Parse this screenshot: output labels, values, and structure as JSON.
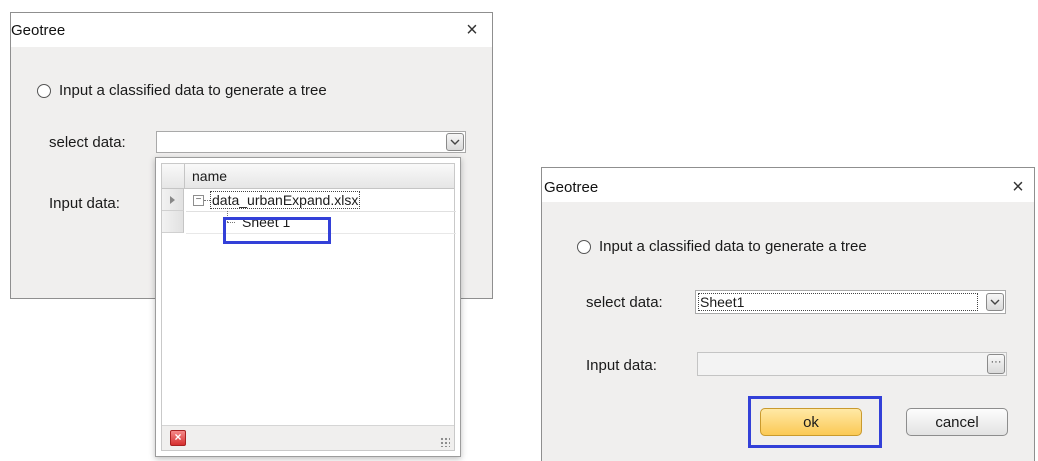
{
  "left_dialog": {
    "title": "Geotree",
    "close_glyph": "×",
    "radio_label": "Input a classified data to generate a tree",
    "select_label": "select data:",
    "input_label": "Input data:",
    "select_value": "",
    "dropdown": {
      "column_header": "name",
      "tree": [
        {
          "label": "data_urbanExpand.xlsx",
          "expander": "−"
        },
        {
          "label": "Sheet 1"
        }
      ],
      "clear_glyph": "×"
    }
  },
  "right_dialog": {
    "title": "Geotree",
    "close_glyph": "×",
    "radio_label": "Input a classified data to generate a tree",
    "select_label": "select data:",
    "select_value": "Sheet1",
    "input_label": "Input data:",
    "input_value": "",
    "ellipsis_glyph": "···",
    "ok_label": "ok",
    "cancel_label": "cancel"
  },
  "colors": {
    "highlight": "#3340d8",
    "ok_button": "#fbc955",
    "clear_button": "#d62f2f"
  },
  "icons": [
    "close-icon",
    "radio-icon",
    "chevron-down-icon",
    "expander-minus-icon",
    "row-arrow-icon",
    "clear-x-icon",
    "resize-grip-icon",
    "ellipsis-icon"
  ]
}
